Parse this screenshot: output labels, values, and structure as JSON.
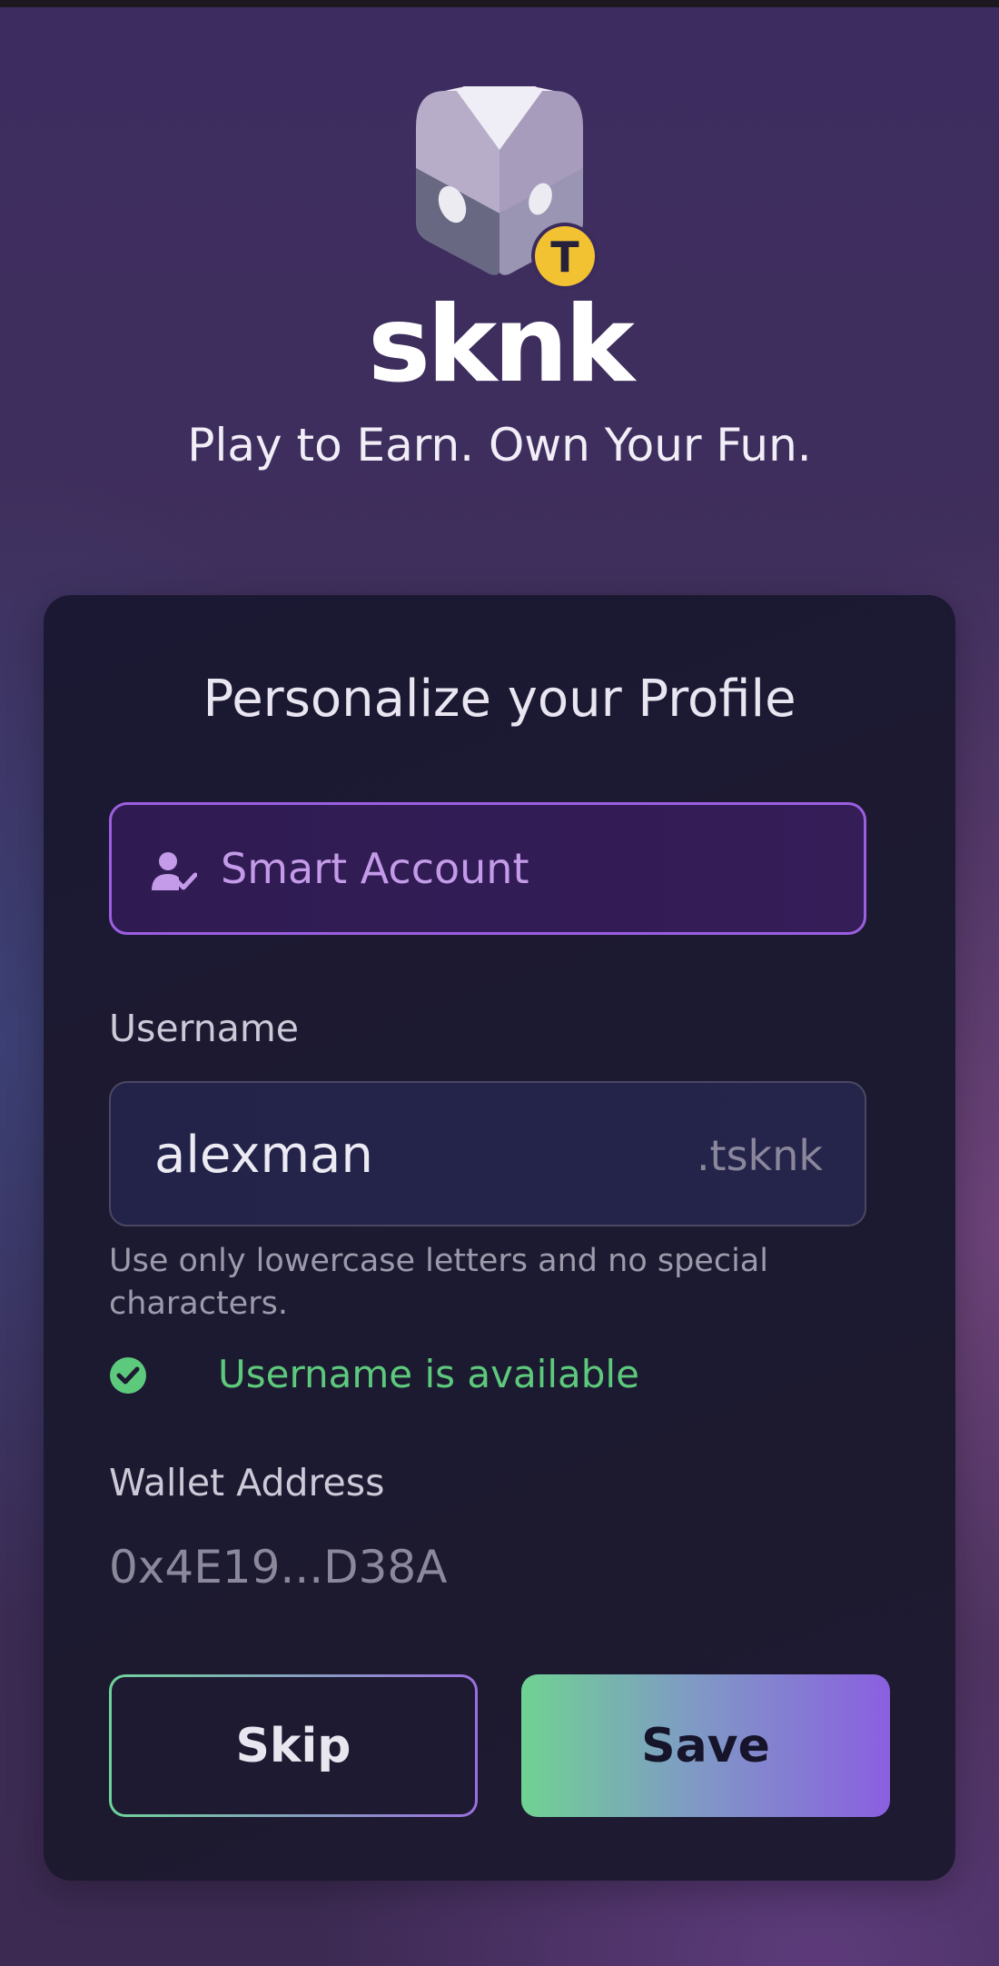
{
  "brand": {
    "name": "sknk",
    "badge_letter": "T",
    "tagline": "Play to Earn. Own Your Fun."
  },
  "card": {
    "title": "Personalize your Profile",
    "account": {
      "icon": "user-check-icon",
      "label": "Smart Account"
    },
    "username": {
      "label": "Username",
      "value": "alexman",
      "suffix": ".tsknk",
      "hint": "Use only lowercase letters and no special characters.",
      "status_icon": "check-circle-icon",
      "status": "Username is available"
    },
    "wallet": {
      "label": "Wallet Address",
      "value": "0x4E19...D38A"
    },
    "buttons": {
      "skip": "Skip",
      "save": "Save"
    }
  },
  "colors": {
    "accent_purple": "#9b5fe0",
    "success_green": "#5dc97c",
    "badge_yellow": "#f2c233"
  }
}
